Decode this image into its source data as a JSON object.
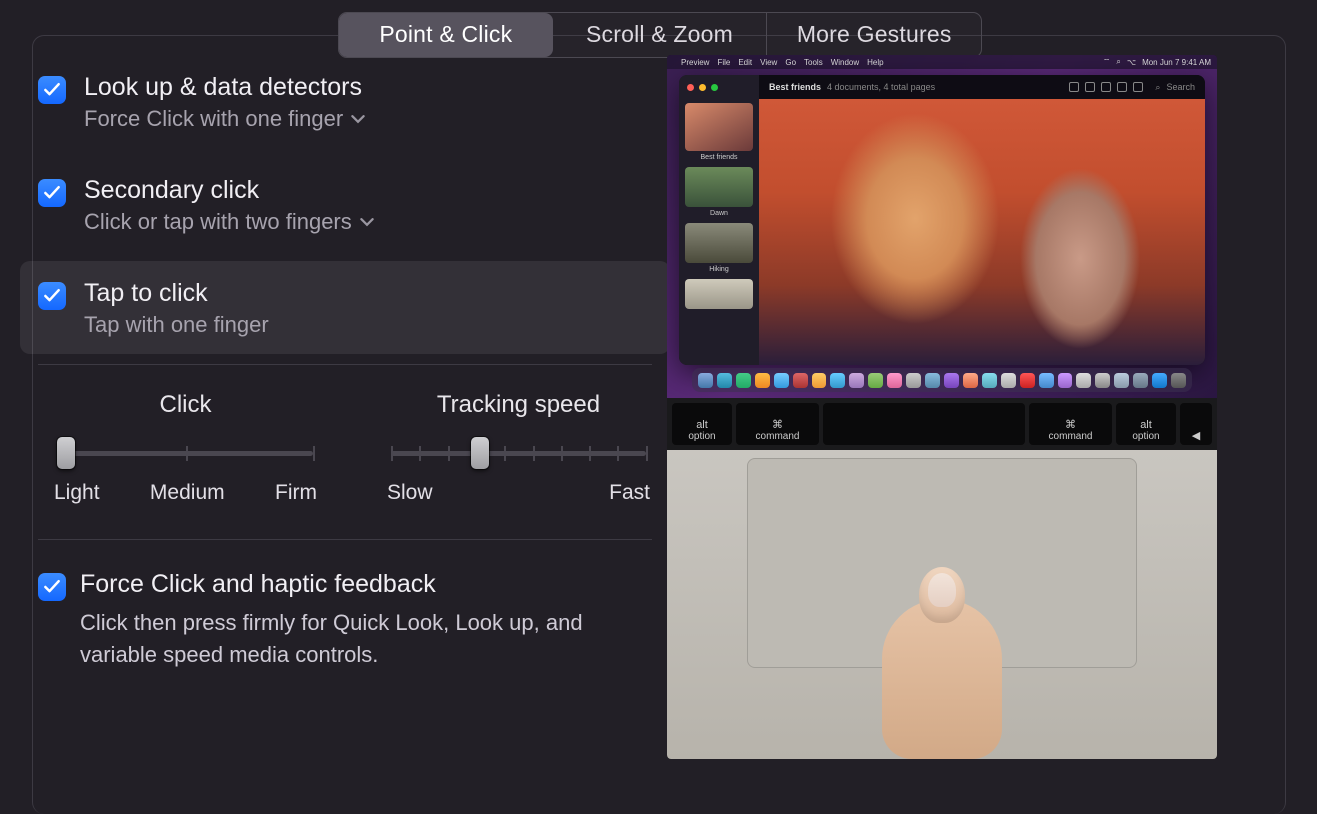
{
  "tabs": {
    "t0": "Point & Click",
    "t1": "Scroll & Zoom",
    "t2": "More Gestures"
  },
  "options": {
    "lookup": {
      "title": "Look up & data detectors",
      "sub": "Force Click with one finger"
    },
    "secondary": {
      "title": "Secondary click",
      "sub": "Click or tap with two fingers"
    },
    "tap": {
      "title": "Tap to click",
      "sub": "Tap with one finger"
    }
  },
  "sliders": {
    "click": {
      "title": "Click",
      "l0": "Light",
      "l1": "Medium",
      "l2": "Firm"
    },
    "tracking": {
      "title": "Tracking speed",
      "l0": "Slow",
      "l1": "Fast"
    }
  },
  "force": {
    "title": "Force Click and haptic feedback",
    "desc": "Click then press firmly for Quick Look, Look up, and variable speed media controls."
  },
  "preview": {
    "menubar": {
      "app": "Preview",
      "items": [
        "File",
        "Edit",
        "View",
        "Go",
        "Tools",
        "Window",
        "Help"
      ],
      "time": "Mon Jun 7  9:41 AM"
    },
    "sidebar": {
      "l1": "Best friends",
      "l2": "Dawn",
      "l3": "Hiking"
    },
    "window": {
      "title": "Best friends",
      "subtitle": "4 documents, 4 total pages",
      "search": "Search"
    },
    "keys": {
      "opt": "option",
      "alt": "alt",
      "cmd": "command",
      "cmdSym": "⌘"
    }
  }
}
